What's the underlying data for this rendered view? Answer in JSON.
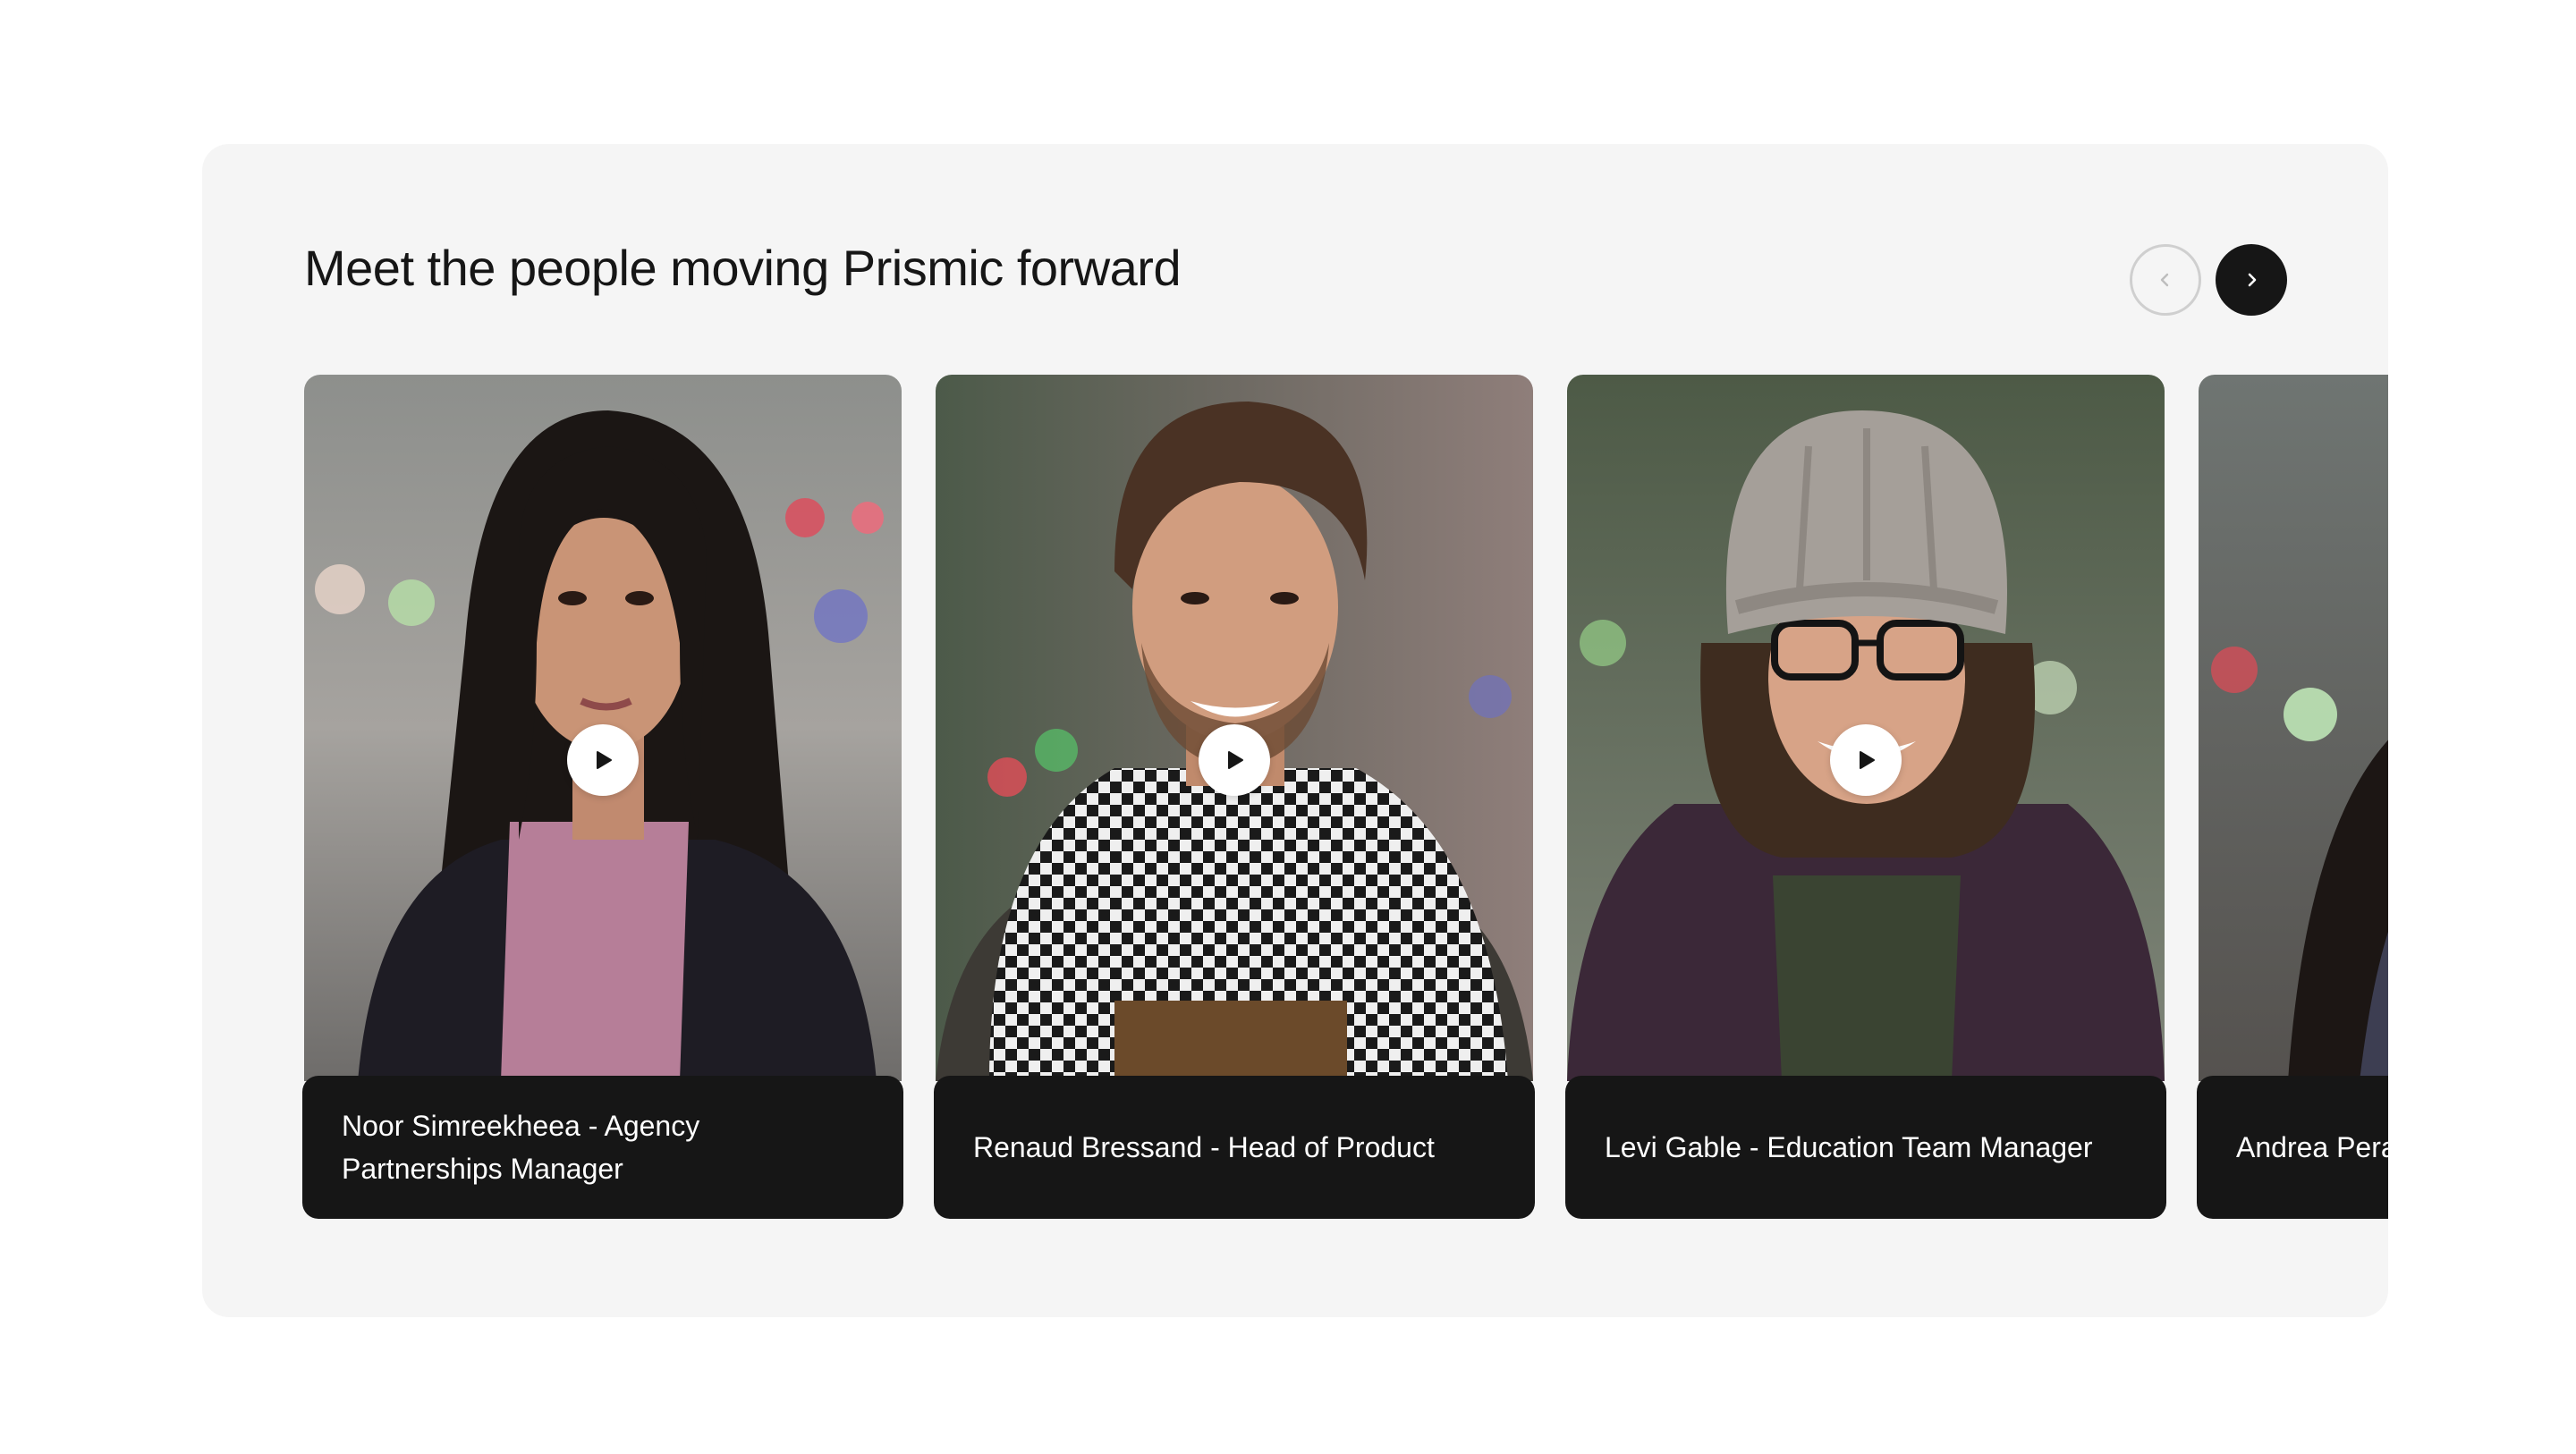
{
  "section": {
    "title": "Meet the people moving Prismic forward"
  },
  "nav": {
    "prev_icon": "chevron-left-icon",
    "next_icon": "chevron-right-icon"
  },
  "cards": [
    {
      "caption": "Noor Simreekheea - Agency Partnerships Manager",
      "play_icon": "play-icon"
    },
    {
      "caption": "Renaud Bressand - Head of Product",
      "play_icon": "play-icon"
    },
    {
      "caption": "Levi Gable - Education Team Manager",
      "play_icon": "play-icon"
    },
    {
      "caption": "Andrea Pera",
      "play_icon": "play-icon"
    }
  ],
  "colors": {
    "panel_bg": "#f5f5f5",
    "caption_bg": "#161616",
    "caption_text": "#ffffff",
    "heading_text": "#161616"
  }
}
